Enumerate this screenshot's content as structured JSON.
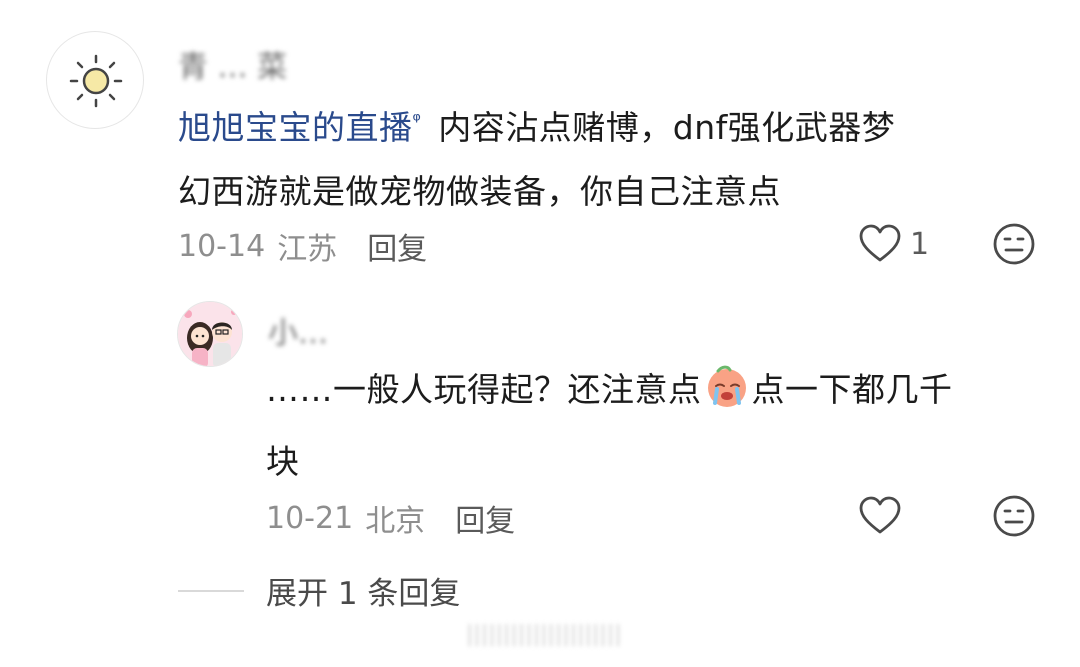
{
  "comment1": {
    "username": "青 … 菜",
    "mention": "旭旭宝宝的直播",
    "mention_mark": "ᵠ",
    "text_line1": " 内容沾点赌博，dnf强化武器梦",
    "text_line2": "幻西游就是做宠物做装备，你自己注意点",
    "date": "10-14",
    "location": "江苏",
    "reply_label": "回复",
    "like_count": "1"
  },
  "comment2": {
    "username": "小…",
    "text_line1": "……一般人玩得起？还注意点",
    "text_line1b": "点一下都几千",
    "text_line2": "块",
    "date": "10-21",
    "location": "北京",
    "reply_label": "回复"
  },
  "expand_replies": "展开 1 条回复",
  "watermark": "|||||||||||||||||||||"
}
